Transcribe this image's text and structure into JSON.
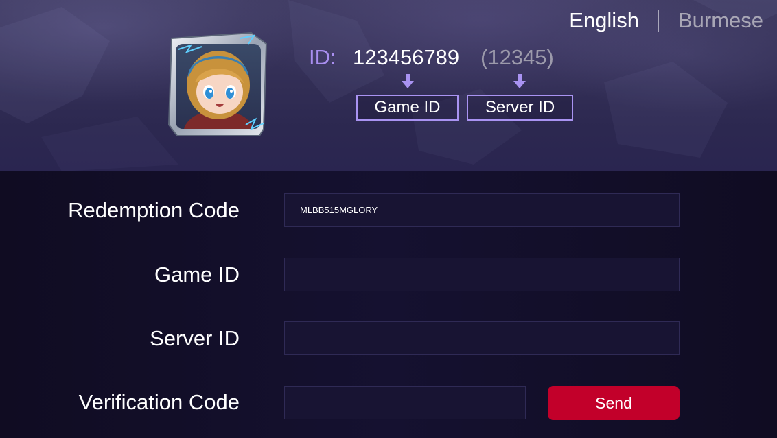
{
  "language": {
    "options": [
      "English",
      "Burmese"
    ],
    "selected": "English"
  },
  "player": {
    "avatar_icon": "hero-portrait-avatar",
    "id_label": "ID:",
    "game_id_example": "123456789",
    "server_id_example": "(12345)",
    "game_id_caption": "Game ID",
    "server_id_caption": "Server ID"
  },
  "form": {
    "redemption_code_label": "Redemption Code",
    "redemption_code_value": "MLBB515MGLORY",
    "game_id_label": "Game ID",
    "game_id_value": "",
    "server_id_label": "Server ID",
    "server_id_value": "",
    "verification_code_label": "Verification Code",
    "verification_code_value": "",
    "send_label": "Send"
  },
  "colors": {
    "accent_purple": "#a993f2",
    "send_button": "#c2002a",
    "background": "#130f26",
    "banner": "#332f56"
  }
}
